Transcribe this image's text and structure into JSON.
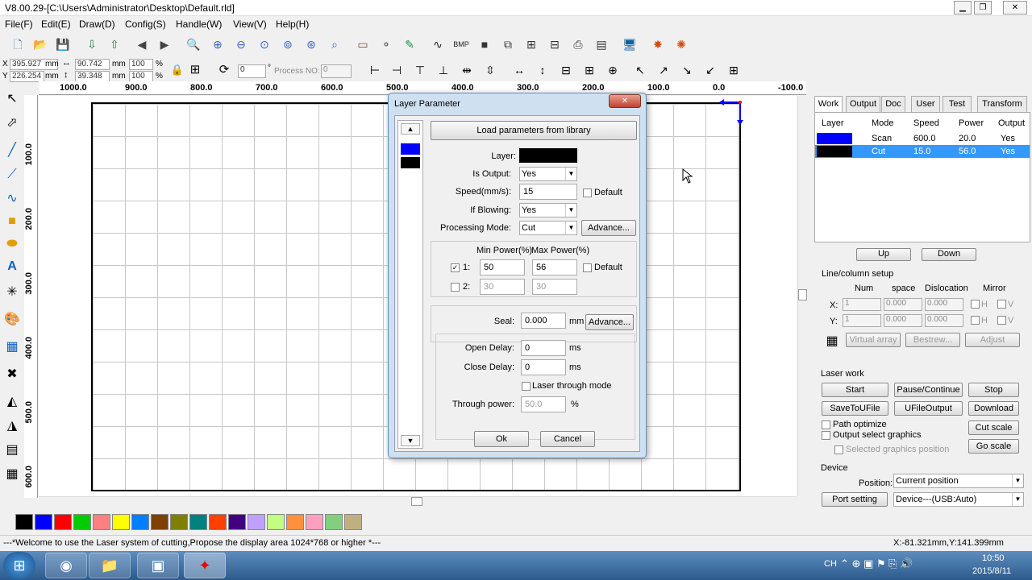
{
  "window": {
    "title": "V8.00.29-[C:\\Users\\Administrator\\Desktop\\Default.rld]"
  },
  "menu": [
    "File(F)",
    "Edit(E)",
    "Draw(D)",
    "Config(S)",
    "Handle(W)",
    "View(V)",
    "Help(H)"
  ],
  "props": {
    "x_label": "X",
    "x_value": "395.927",
    "x_unit": "mm",
    "y_label": "Y",
    "y_value": "226.254",
    "y_unit": "mm",
    "w_value": "90.742",
    "w_unit": "mm",
    "h_value": "39.348",
    "h_unit": "mm",
    "sx_value": "100",
    "sx_unit": "%",
    "sy_value": "100",
    "sy_unit": "%",
    "angle_value": "0",
    "angle_unit": "°",
    "process_no_label": "Process NO:",
    "process_no_value": "0"
  },
  "ruler_top": [
    "1000.0",
    "900.0",
    "800.0",
    "700.0",
    "600.0",
    "500.0",
    "400.0",
    "300.0",
    "200.0",
    "100.0",
    "0.0",
    "-100.0"
  ],
  "ruler_left": [
    "100.0",
    "200.0",
    "300.0",
    "400.0",
    "500.0",
    "600.0"
  ],
  "palette": [
    "#000000",
    "#0000ff",
    "#ff0000",
    "#00cc00",
    "#ff8080",
    "#ffff00",
    "#0080ff",
    "#804000",
    "#808000",
    "#008080",
    "#ff4000",
    "#400080",
    "#c0a0ff",
    "#c0ff80",
    "#ff9040",
    "#ffa0c0",
    "#80d080",
    "#c0b080"
  ],
  "status": {
    "message": "---*Welcome to use the Laser system of cutting,Propose the display area 1024*768 or higher *---",
    "coords": "X:-81.321mm,Y:141.399mm"
  },
  "taskbar": {
    "time": "10:50",
    "date": "2015/8/11",
    "lang": "CH"
  },
  "right_panel": {
    "tabs": [
      "Work",
      "Output",
      "Doc",
      "User",
      "Test",
      "Transform"
    ],
    "layer_headers": [
      "Layer",
      "Mode",
      "Speed",
      "Power",
      "Output"
    ],
    "layers": [
      {
        "color": "#0000ff",
        "mode": "Scan",
        "speed": "600.0",
        "power": "20.0",
        "output": "Yes"
      },
      {
        "color": "#000000",
        "mode": "Cut",
        "speed": "15.0",
        "power": "56.0",
        "output": "Yes"
      }
    ],
    "up": "Up",
    "down": "Down",
    "line_col_title": "Line/column setup",
    "lc_headers": [
      "Num",
      "space",
      "Dislocation",
      "Mirror"
    ],
    "x_label": "X:",
    "y_label": "Y:",
    "x_num": "1",
    "x_space": "0.000",
    "x_disloc": "0.000",
    "y_num": "1",
    "y_space": "0.000",
    "y_disloc": "0.000",
    "mirror_h": "H",
    "mirror_v": "V",
    "virtual_array": "Virtual array",
    "bestrew": "Bestrew...",
    "adjust": "Adjust",
    "laser_work": "Laser work",
    "start": "Start",
    "pause": "Pause/Continue",
    "stop": "Stop",
    "save_to_ufile": "SaveToUFile",
    "ufile_output": "UFileOutput",
    "download": "Download",
    "path_optimize": "Path optimize",
    "output_select": "Output select graphics",
    "selected_pos": "Selected graphics position",
    "cut_scale": "Cut scale",
    "go_scale": "Go scale",
    "device_title": "Device",
    "position_label": "Position:",
    "position_value": "Current position",
    "port_setting": "Port setting",
    "device_value": "Device---(USB:Auto)"
  },
  "dialog": {
    "title": "Layer Parameter",
    "load_library": "Load parameters from library",
    "layer_label": "Layer:",
    "is_output_label": "Is Output:",
    "is_output_value": "Yes",
    "speed_label": "Speed(mm/s):",
    "speed_value": "15",
    "default_label": "Default",
    "if_blowing_label": "If Blowing:",
    "if_blowing_value": "Yes",
    "processing_mode_label": "Processing Mode:",
    "processing_mode_value": "Cut",
    "advance": "Advance...",
    "min_power_header": "Min Power(%)",
    "max_power_header": "Max Power(%)",
    "row1_label": "1:",
    "row1_min": "50",
    "row1_max": "56",
    "row2_label": "2:",
    "row2_min": "30",
    "row2_max": "30",
    "seal_label": "Seal:",
    "seal_value": "0.000",
    "seal_unit": "mm",
    "open_delay_label": "Open Delay:",
    "open_delay_value": "0",
    "open_delay_unit": "ms",
    "close_delay_label": "Close Delay:",
    "close_delay_value": "0",
    "close_delay_unit": "ms",
    "laser_through": "Laser through mode",
    "through_power_label": "Through power:",
    "through_power_value": "50.0",
    "through_power_unit": "%",
    "ok": "Ok",
    "cancel": "Cancel",
    "layer_colors": [
      "#0000ff",
      "#000000"
    ]
  }
}
